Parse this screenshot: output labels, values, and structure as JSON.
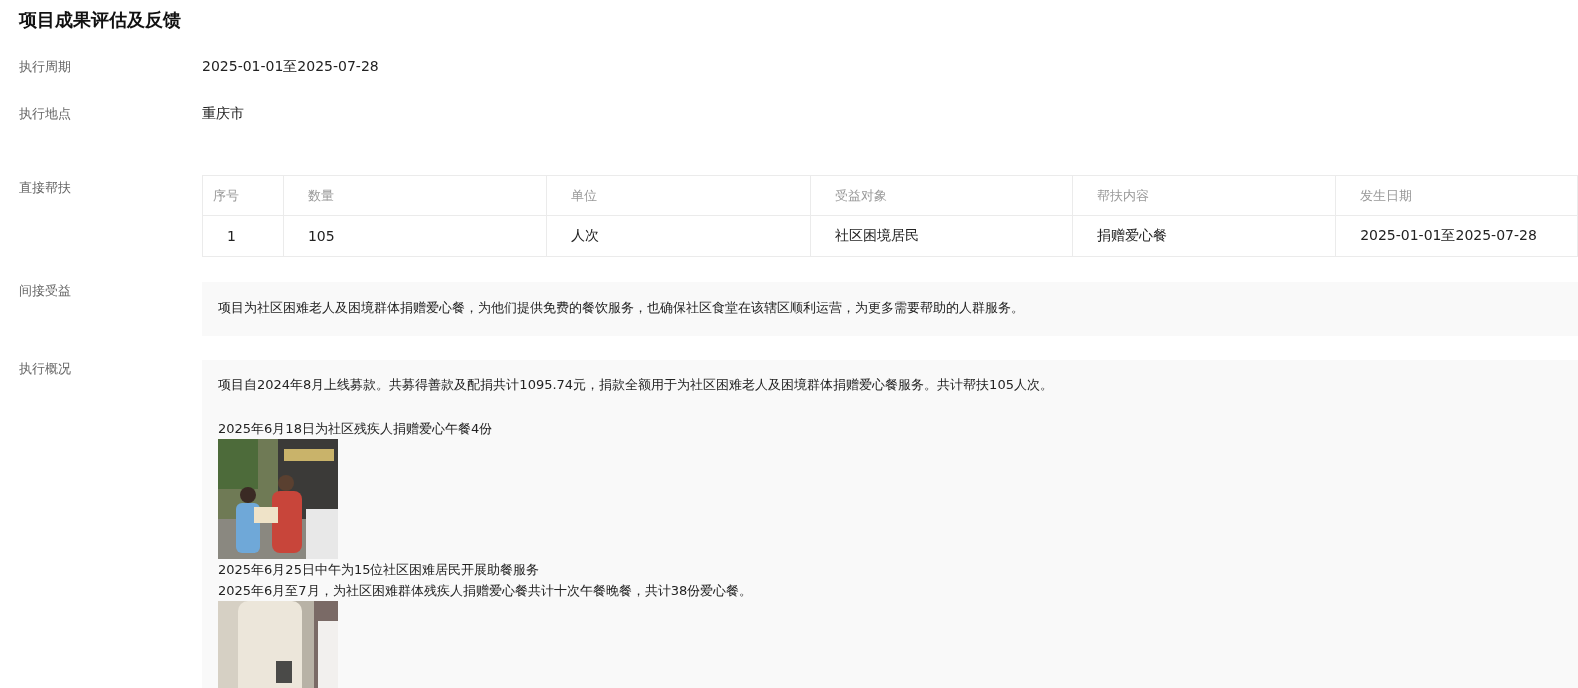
{
  "title": "项目成果评估及反馈",
  "fields": [
    {
      "label": "执行周期",
      "value": "2025-01-01至2025-07-28"
    },
    {
      "label": "执行地点",
      "value": "重庆市"
    }
  ],
  "direct_help": {
    "label": "直接帮扶",
    "columns": [
      "序号",
      "数量",
      "单位",
      "受益对象",
      "帮扶内容",
      "发生日期"
    ],
    "rows": [
      [
        "1",
        "105",
        "人次",
        "社区困境居民",
        "捐赠爱心餐",
        "2025-01-01至2025-07-28"
      ]
    ]
  },
  "indirect_benefit": {
    "label": "间接受益",
    "text": "项目为社区困难老人及困境群体捐赠爱心餐，为他们提供免费的餐饮服务，也确保社区食堂在该辖区顺利运营，为更多需要帮助的人群服务。"
  },
  "execution": {
    "label": "执行概况",
    "blocks": [
      {
        "kind": "paragraph",
        "text": "项目自2024年8月上线募款。共募得善款及配捐共计1095.74元，捐款全额用于为社区困难老人及困境群体捐赠爱心餐服务。共计帮扶105人次。"
      },
      {
        "kind": "line",
        "text": "2025年6月18日为社区残疾人捐赠爱心午餐4份"
      },
      {
        "kind": "picture"
      },
      {
        "kind": "line",
        "text": "2025年6月25日中午为15位社区困难居民开展助餐服务"
      },
      {
        "kind": "line",
        "text": "2025年6月至7月，为社区困难群体残疾人捐赠爱心餐共计十次午餐晚餐，共计38份爱心餐。"
      },
      {
        "kind": "picture"
      }
    ]
  }
}
